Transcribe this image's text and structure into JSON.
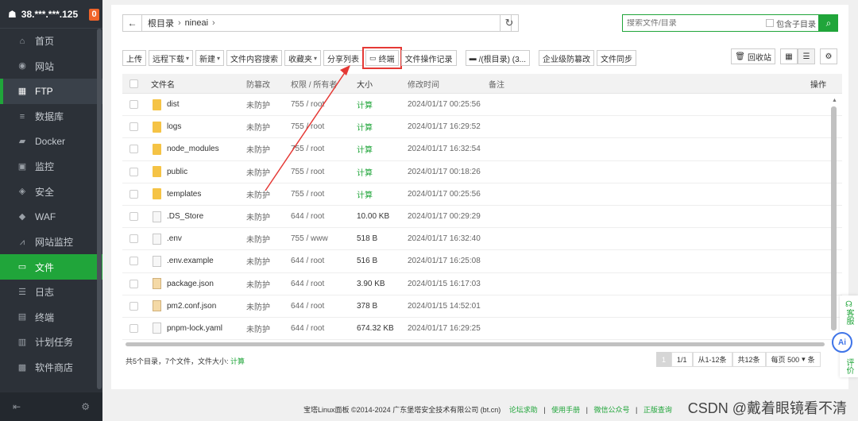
{
  "server": {
    "ip": "38.***.***.125",
    "badge": "0"
  },
  "sidebar": {
    "items": [
      {
        "label": "首页",
        "icon": "home-icon"
      },
      {
        "label": "网站",
        "icon": "globe-icon"
      },
      {
        "label": "FTP",
        "icon": "ftp-icon"
      },
      {
        "label": "数据库",
        "icon": "database-icon"
      },
      {
        "label": "Docker",
        "icon": "docker-icon"
      },
      {
        "label": "监控",
        "icon": "monitor-icon"
      },
      {
        "label": "安全",
        "icon": "shield-icon"
      },
      {
        "label": "WAF",
        "icon": "waf-icon"
      },
      {
        "label": "网站监控",
        "icon": "chart-icon"
      },
      {
        "label": "文件",
        "icon": "folder-icon"
      },
      {
        "label": "日志",
        "icon": "log-icon"
      },
      {
        "label": "终端",
        "icon": "terminal-icon"
      },
      {
        "label": "计划任务",
        "icon": "clock-icon"
      },
      {
        "label": "软件商店",
        "icon": "store-icon"
      }
    ]
  },
  "path": {
    "root": "根目录",
    "dir": "nineai"
  },
  "search": {
    "placeholder": "搜索文件/目录",
    "sub_label": "包含子目录"
  },
  "toolbar": {
    "upload": "上传",
    "remote_download": "远程下载",
    "new": "新建",
    "content_search": "文件内容搜索",
    "favorites": "收藏夹",
    "share_list": "分享列表",
    "terminal": "终端",
    "file_log": "文件操作记录",
    "disk": "/(根目录) (3...",
    "tamper": "企业级防篡改",
    "sync": "文件同步",
    "recycle": "回收站"
  },
  "table": {
    "headers": {
      "name": "文件名",
      "protect": "防篡改",
      "perm": "权限 / 所有者",
      "size": "大小",
      "mtime": "修改时间",
      "note": "备注",
      "op": "操作"
    },
    "rows": [
      {
        "name": "dist",
        "type": "folder",
        "protect": "未防护",
        "perm": "755 / root",
        "size": "计算",
        "mtime": "2024/01/17 00:25:56"
      },
      {
        "name": "logs",
        "type": "folder",
        "protect": "未防护",
        "perm": "755 / root",
        "size": "计算",
        "mtime": "2024/01/17 16:29:52"
      },
      {
        "name": "node_modules",
        "type": "folder",
        "protect": "未防护",
        "perm": "755 / root",
        "size": "计算",
        "mtime": "2024/01/17 16:32:54"
      },
      {
        "name": "public",
        "type": "folder",
        "protect": "未防护",
        "perm": "755 / root",
        "size": "计算",
        "mtime": "2024/01/17 00:18:26"
      },
      {
        "name": "templates",
        "type": "folder",
        "protect": "未防护",
        "perm": "755 / root",
        "size": "计算",
        "mtime": "2024/01/17 00:25:56"
      },
      {
        "name": ".DS_Store",
        "type": "file",
        "protect": "未防护",
        "perm": "644 / root",
        "size": "10.00 KB",
        "mtime": "2024/01/17 00:29:29"
      },
      {
        "name": ".env",
        "type": "file",
        "protect": "未防护",
        "perm": "755 / www",
        "size": "518 B",
        "mtime": "2024/01/17 16:32:40"
      },
      {
        "name": ".env.example",
        "type": "file",
        "protect": "未防护",
        "perm": "644 / root",
        "size": "516 B",
        "mtime": "2024/01/17 16:25:08"
      },
      {
        "name": "package.json",
        "type": "json",
        "protect": "未防护",
        "perm": "644 / root",
        "size": "3.90 KB",
        "mtime": "2024/01/15 16:17:03"
      },
      {
        "name": "pm2.conf.json",
        "type": "json",
        "protect": "未防护",
        "perm": "644 / root",
        "size": "378 B",
        "mtime": "2024/01/15 14:52:01"
      },
      {
        "name": "pnpm-lock.yaml",
        "type": "file",
        "protect": "未防护",
        "perm": "644 / root",
        "size": "674.32 KB",
        "mtime": "2024/01/17 16:29:25"
      }
    ]
  },
  "summary": {
    "text": "共5个目录，7个文件，文件大小:",
    "calc": "计算"
  },
  "pager": {
    "current": "1",
    "pages": "1/1",
    "range": "从1-12条",
    "total": "共12条",
    "per_page_label": "每页",
    "per_page": "500",
    "unit": "条"
  },
  "footer": {
    "copyright": "宝塔Linux面板 ©2014-2024 广东堡塔安全技术有限公司 (bt.cn)",
    "links": [
      "论坛求助",
      "使用手册",
      "微信公众号",
      "正版查询"
    ]
  },
  "watermark": "CSDN @戴着眼镜看不清",
  "widget": {
    "service": "客服",
    "review": "评价",
    "ai": "Ai"
  }
}
